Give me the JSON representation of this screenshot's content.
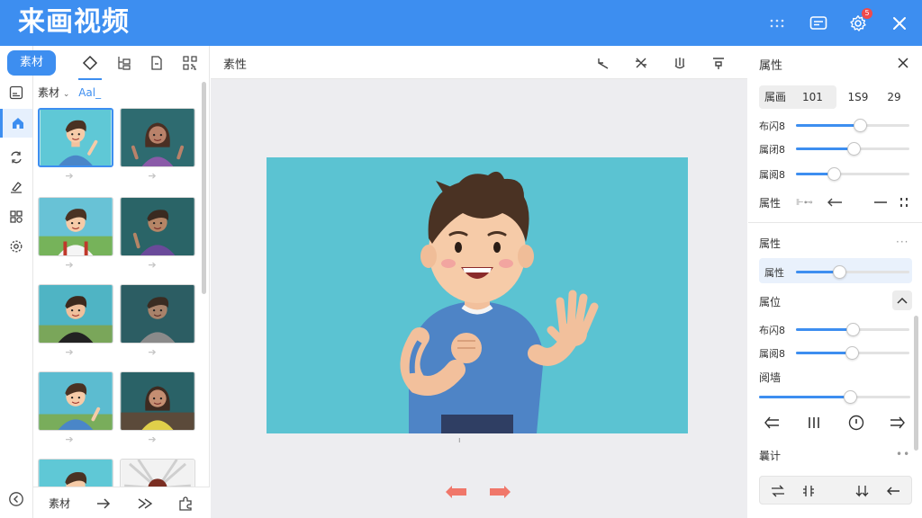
{
  "app": {
    "title": "来画视频",
    "settings_badge": "5"
  },
  "assets": {
    "tab_label": "素材",
    "filter_label": "素材",
    "filter_caret": "⌄",
    "filter_value": "Aal_",
    "bottom_label": "素材"
  },
  "canvas": {
    "title": "素性",
    "marker": "ı"
  },
  "props": {
    "title": "属性",
    "segments": [
      "属画",
      "101",
      "1S9",
      "29"
    ],
    "rows_top": [
      {
        "label": "布闪8",
        "value": 0.56
      },
      {
        "label": "属闭8",
        "value": 0.51
      },
      {
        "label": "属阅8",
        "value": 0.33
      }
    ],
    "attr_row_label": "属性",
    "attr_row_small": "⊩⊷",
    "section2_title": "属性",
    "section2_more": "···",
    "highlight_label": "属性",
    "highlight_value": 0.38,
    "section3_title": "属位",
    "rows_mid": [
      {
        "label": "布闪8",
        "value": 0.5
      },
      {
        "label": "属阅8",
        "value": 0.49
      }
    ],
    "wide_label": "阅墙",
    "wide_value": 0.6,
    "section4_title": "曩计",
    "section4_more": "••"
  },
  "colors": {
    "brand": "#3d8ef0",
    "stage_bg": "#5bc3d2",
    "arrow": "#f0776a"
  }
}
